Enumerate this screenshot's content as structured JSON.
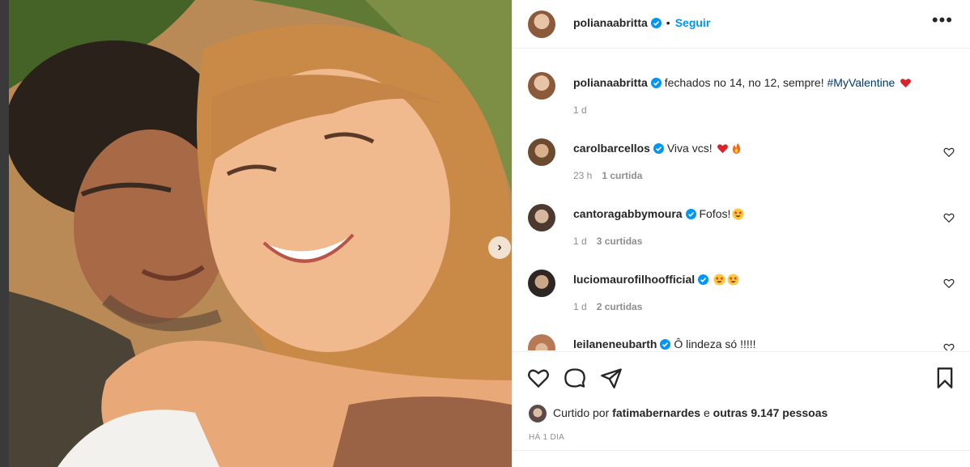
{
  "post": {
    "author": "polianaabritta",
    "follow_label": "Seguir",
    "separator": "•",
    "more_label": "•••",
    "caption": "fechados no 14, no 12, sempre! ",
    "hashtag": "#MyValentine",
    "caption_age": "1 d"
  },
  "comments": [
    {
      "user": "carolbarcellos",
      "text": "Viva vcs!",
      "age": "23 h",
      "likes": "1 curtida"
    },
    {
      "user": "cantoragabbymoura",
      "text": "Fofos!",
      "age": "1 d",
      "likes": "3 curtidas"
    },
    {
      "user": "luciomaurofilhoofficial",
      "text": "",
      "age": "1 d",
      "likes": "2 curtidas"
    },
    {
      "user": "leilaneneubarth",
      "text": "Ô lindeza só !!!!!",
      "age": "",
      "likes": ""
    }
  ],
  "likes": {
    "prefix": "Curtido por ",
    "user": "fatimabernardes",
    "middle": " e ",
    "others": "outras 9.147 pessoas"
  },
  "post_date": "HÁ 1 DIA",
  "icons": {
    "like": "heart-icon",
    "comment": "comment-icon",
    "share": "share-icon",
    "save": "bookmark-icon",
    "verified": "verified-badge-icon",
    "next": "chevron-right-icon"
  },
  "colors": {
    "link": "#0095f6",
    "hashtag": "#00376b",
    "muted": "#8e8e8e",
    "heart": "#ed4956"
  }
}
